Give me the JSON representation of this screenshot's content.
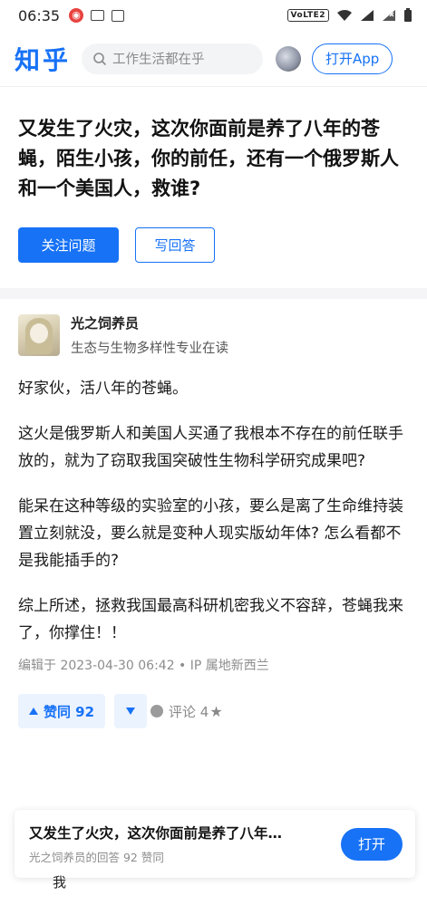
{
  "status_bar": {
    "time": "06:35",
    "network": "VoLTE2"
  },
  "header": {
    "logo": "知乎",
    "search_placeholder": "工作生活都在乎",
    "open_app": "打开App"
  },
  "question": {
    "title": "又发生了火灾，这次你面前是养了八年的苍蝇，陌生小孩，你的前任，还有一个俄罗斯人和一个美国人，救谁?",
    "follow_label": "关注问题",
    "write_label": "写回答"
  },
  "answer": {
    "author_name": "光之饲养员",
    "author_desc": "生态与生物多样性专业在读",
    "paragraphs": [
      "好家伙，活八年的苍蝇。",
      "这火是俄罗斯人和美国人买通了我根本不存在的前任联手放的，就为了窃取我国突破性生物科学研究成果吧?",
      "能呆在这种等级的实验室的小孩，要么是离了生命维持装置立刻就没，要么就是变种人现实版幼年体? 怎么看都不是我能插手的?",
      "综上所述，拯救我国最高科研机密我义不容辞，苍蝇我来了，你撑住！！"
    ],
    "edit_meta": "编辑于 2023-04-30 06:42 • IP 属地新西兰",
    "vote_label": "赞同 92",
    "comment_label": "评论 4"
  },
  "bottom_card": {
    "title": "又发生了火灾，这次你面前是养了八年…",
    "subtitle": "光之饲养员的回答 92 赞同",
    "open_label": "打开"
  },
  "cut_text": "我",
  "colors": {
    "brand": "#1772f6",
    "vote_bg": "#ebf3ff"
  }
}
